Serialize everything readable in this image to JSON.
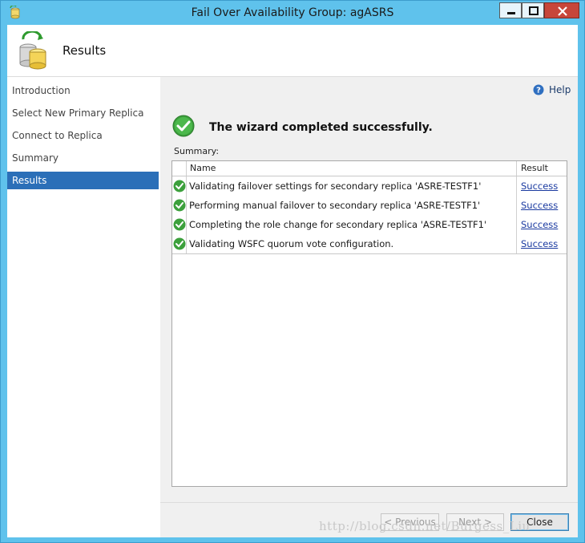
{
  "window": {
    "title": "Fail Over Availability Group: agASRS",
    "controls": [
      "minimize-icon",
      "maximize-icon",
      "close-icon"
    ]
  },
  "header": {
    "title": "Results",
    "icon": "database-refresh-icon"
  },
  "nav": {
    "items": [
      {
        "label": "Introduction",
        "active": false
      },
      {
        "label": "Select New Primary Replica",
        "active": false
      },
      {
        "label": "Connect to Replica",
        "active": false
      },
      {
        "label": "Summary",
        "active": false
      },
      {
        "label": "Results",
        "active": true
      }
    ]
  },
  "main": {
    "help_label": "Help",
    "status_message": "The wizard completed successfully.",
    "summary_label": "Summary:",
    "table": {
      "columns": [
        "Name",
        "Result"
      ],
      "rows": [
        {
          "name": "Validating failover settings for secondary replica 'ASRE-TESTF1'",
          "result": "Success"
        },
        {
          "name": "Performing manual failover to secondary replica 'ASRE-TESTF1'",
          "result": "Success"
        },
        {
          "name": "Completing the role change for secondary replica 'ASRE-TESTF1'",
          "result": "Success"
        },
        {
          "name": "Validating WSFC quorum vote configuration.",
          "result": "Success"
        }
      ]
    }
  },
  "footer": {
    "previous_label": "< Previous",
    "next_label": "Next >",
    "close_label": "Close"
  },
  "watermark": "http://blog.csdn.net/Burgess_Liu",
  "colors": {
    "titlebar": "#5fc2ec",
    "nav_active": "#2b6fb8",
    "success_green": "#3ca03c",
    "link": "#1a3aa0",
    "close_button": "#c7463a"
  }
}
